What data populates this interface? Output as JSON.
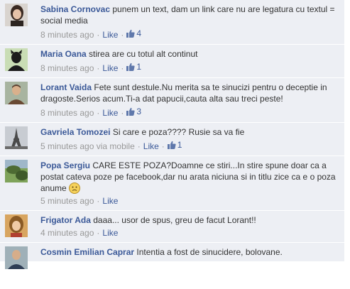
{
  "comments": [
    {
      "author": "Sabina Cornovac",
      "text": "punem un text, dam un link care nu are legatura cu textul = social media",
      "time": "8 minutes ago",
      "like": "Like",
      "likes": "4",
      "via": "",
      "avatar_icon": "profile-photo-woman"
    },
    {
      "author": "Maria Oana",
      "text": "stirea are cu totul alt continut",
      "time": "8 minutes ago",
      "like": "Like",
      "likes": "1",
      "via": "",
      "avatar_icon": "profile-photo-silhouette"
    },
    {
      "author": "Lorant Vaida",
      "text": "Fete sunt destule.Nu merita sa te sinucizi pentru o deceptie in dragoste.Serios acum.Ti-a dat papucii,cauta alta sau treci peste!",
      "time": "8 minutes ago",
      "like": "Like",
      "likes": "3",
      "via": "",
      "avatar_icon": "profile-photo-man"
    },
    {
      "author": "Gavriela Tomozei",
      "text": "Si care e poza???? Rusie sa va fie",
      "time": "5 minutes ago",
      "like": "Like",
      "likes": "1",
      "via": "via mobile",
      "avatar_icon": "profile-photo-eiffel-tower"
    },
    {
      "author": "Popa Sergiu",
      "text": "CARE ESTE POZA?Doamne ce stiri...In stire spune doar ca a postat cateva poze pe facebook,dar nu arata niciuna si in titlu zice ca e o poza anume",
      "time": "5 minutes ago",
      "like": "Like",
      "likes": "",
      "via": "",
      "avatar_icon": "profile-photo-landscape",
      "emoticon": "sad-face-emoticon"
    },
    {
      "author": "Frigator Ada",
      "text": "daaa... usor de spus, greu de facut Lorant!!",
      "time": "4 minutes ago",
      "like": "Like",
      "likes": "",
      "via": "",
      "avatar_icon": "profile-photo-woman-blonde"
    },
    {
      "author": "Cosmin Emilian Caprar",
      "text": "Intentia a fost de sinucidere, bolovane.",
      "time": "",
      "like": "",
      "likes": "",
      "via": "",
      "avatar_icon": "profile-photo-man-2"
    }
  ],
  "colors": {
    "link": "#3b5998",
    "bg": "#edeff4",
    "meta": "#999999"
  }
}
